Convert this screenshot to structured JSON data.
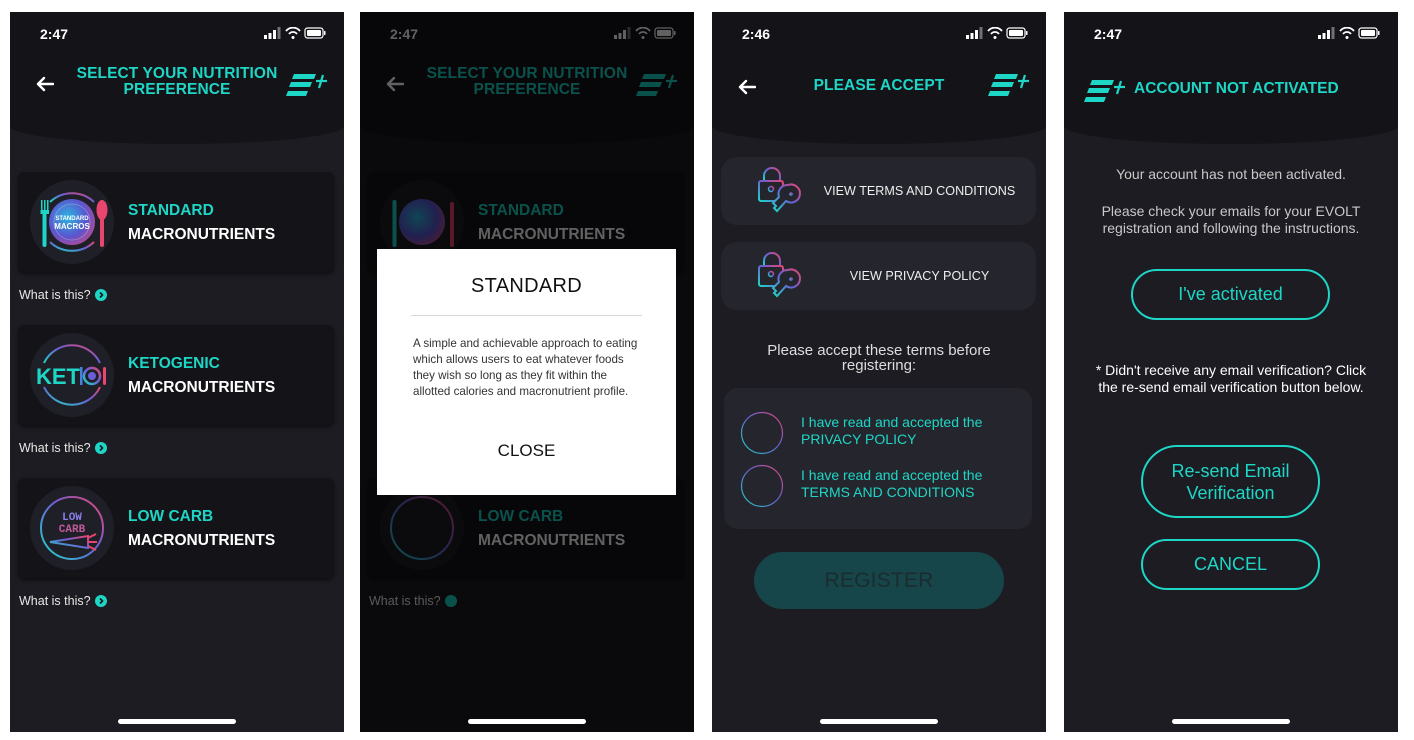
{
  "theme": {
    "accent": "#1ed6c6",
    "background": "#1c1c22",
    "header_bg": "#131318",
    "card_bg": "#25262d",
    "gradient_pink": "#e8456f",
    "gradient_purple": "#6a5fd6"
  },
  "screens": [
    {
      "status_time": "2:47",
      "title_line1": "SELECT YOUR NUTRITION",
      "title_line2": "PREFERENCE",
      "options": [
        {
          "badge_line1": "STANDARD",
          "badge_line2": "MACROS",
          "name": "STANDARD",
          "subtitle": "MACRONUTRIENTS",
          "help": "What is this?"
        },
        {
          "badge_text": "KETO",
          "name": "KETOGENIC",
          "subtitle": "MACRONUTRIENTS",
          "help": "What is this?"
        },
        {
          "badge_line1": "LOW",
          "badge_line2": "CARB",
          "name": "LOW CARB",
          "subtitle": "MACRONUTRIENTS",
          "help": "What is this?"
        }
      ]
    },
    {
      "status_time": "2:47",
      "title_line1": "SELECT YOUR NUTRITION",
      "title_line2": "PREFERENCE",
      "modal": {
        "title": "STANDARD",
        "body": "A simple and achievable approach to eating which allows users to eat whatever foods they wish so long as they fit within the allotted calories and macronutrient profile.",
        "close_label": "CLOSE"
      }
    },
    {
      "status_time": "2:46",
      "title": "PLEASE ACCEPT",
      "links": [
        {
          "label": "VIEW TERMS AND CONDITIONS"
        },
        {
          "label": "VIEW PRIVACY POLICY"
        }
      ],
      "note": "Please accept these terms before registering:",
      "checks": [
        {
          "line1": "I have read and accepted the",
          "line2": "PRIVACY POLICY",
          "checked": false
        },
        {
          "line1": "I have read and accepted the",
          "line2": "TERMS AND CONDITIONS",
          "checked": false
        }
      ],
      "register_label": "REGISTER"
    },
    {
      "status_time": "2:47",
      "title": "ACCOUNT NOT ACTIVATED",
      "msg1": "Your account has not been activated.",
      "msg2": "Please check your emails for your EVOLT registration and following the instructions.",
      "activated_label": "I've activated",
      "msg3": "* Didn't receive any email verification? Click the re-send email verification button below.",
      "resend_label": "Re-send Email Verification",
      "cancel_label": "CANCEL"
    }
  ],
  "icons": {
    "back": "arrow-left",
    "logo": "evolt-logo",
    "signal": "cellular-signal",
    "wifi": "wifi",
    "battery": "battery",
    "help": "chevron-right-circle",
    "lock_key": "padlock-and-key"
  }
}
